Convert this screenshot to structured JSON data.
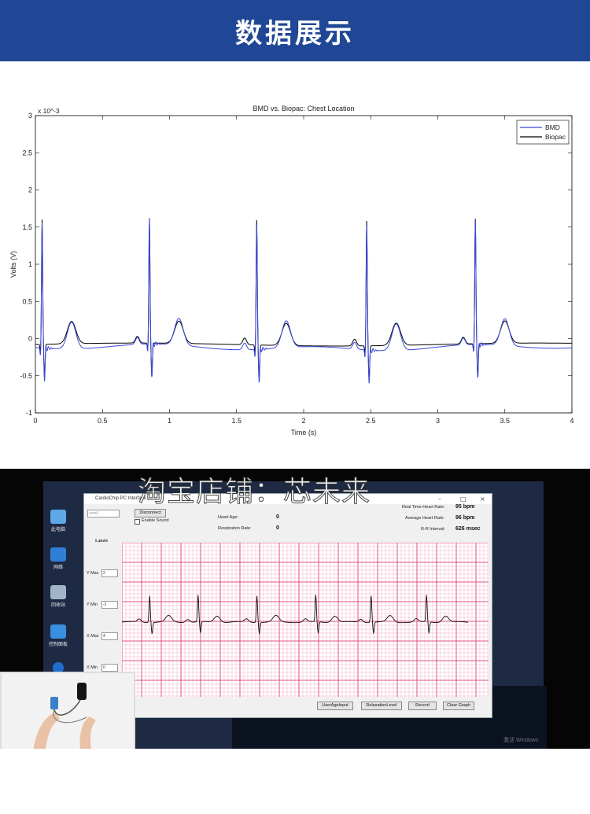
{
  "banner": {
    "title": "数据展示"
  },
  "chart_data": {
    "type": "line",
    "title": "BMD vs. Biopac: Chest Location",
    "xlabel": "Time (s)",
    "ylabel": "Volts (V)",
    "y_exponent": "x 10^-3",
    "xlim": [
      0,
      4
    ],
    "ylim": [
      -1,
      3
    ],
    "x_ticks": [
      "0",
      "0.5",
      "1",
      "1.5",
      "2",
      "2.5",
      "3",
      "3.5",
      "4"
    ],
    "y_ticks": [
      "3",
      "2.5",
      "2",
      "1.5",
      "1",
      "0.5",
      "0",
      "-0.5",
      "-1"
    ],
    "legend": {
      "placement": "top-right"
    },
    "series": [
      {
        "name": "BMD",
        "color": "#3a47e0"
      },
      {
        "name": "Biopac",
        "color": "#000000"
      }
    ],
    "beat_times": [
      0.05,
      0.85,
      1.65,
      2.47,
      3.28
    ],
    "grid": false
  },
  "screenshot": {
    "watermark": "淘宝店铺：芯未来",
    "app": {
      "title": "CardioChip PC Interface",
      "port_placeholder": "com6",
      "disconnect_label": "Disconnect",
      "enable_sound_label": "Enable Sound",
      "heart_age_label": "Heart Age:",
      "heart_age_value": "0",
      "respiration_label": "Respiration Rate:",
      "respiration_value": "0",
      "rt_hr_label": "Real Time Heart Rate:",
      "rt_hr_value": "95 bpm",
      "avg_hr_label": "Average Heart Rate:",
      "avg_hr_value": "96 bpm",
      "rr_label": "R-R Interval:",
      "rr_value": "626 msec",
      "label1": "Label1",
      "ymax_label": "Y Max",
      "ymax_value": "2",
      "ymin_label": "Y Min",
      "ymin_value": "-2",
      "xmax_label": "X Max",
      "xmax_value": "4",
      "xmin_label": "X Min",
      "xmin_value": "0",
      "buttons": [
        "UserAgeInput",
        "RelaxationLevel",
        "Record",
        "Clear Graph"
      ],
      "ecg_grid_color": "#e0427a",
      "ecg_beats": [
        0.08,
        0.22,
        0.39,
        0.56,
        0.72,
        0.88
      ]
    },
    "desktop_labels": [
      "此电脑",
      "网络",
      "回收站",
      "控制面板"
    ],
    "windows_ghost": "激活 Windows"
  }
}
